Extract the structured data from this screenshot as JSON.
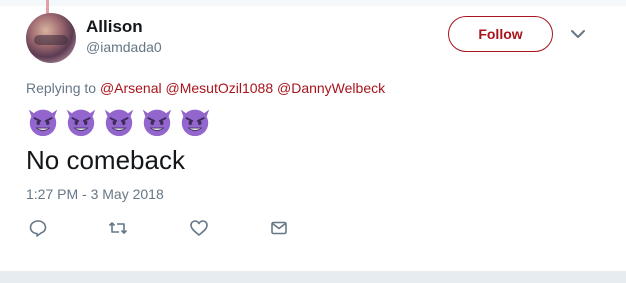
{
  "user": {
    "name": "Allison",
    "handle": "@iamdada0"
  },
  "follow_button": {
    "label": "Follow"
  },
  "reply_context": {
    "prefix": "Replying to",
    "mentions": [
      "@Arsenal",
      "@MesutOzil1088",
      "@DannyWelbeck"
    ]
  },
  "tweet": {
    "emojis": [
      "smiling-imp",
      "smiling-imp",
      "smiling-imp",
      "smiling-imp",
      "smiling-imp"
    ],
    "text": "No comeback",
    "timestamp": "1:27 PM - 3 May 2018"
  },
  "actions": [
    "reply-icon",
    "retweet-icon",
    "like-icon",
    "direct-message-icon"
  ],
  "colors": {
    "accent": "#a8141c",
    "secondary_text": "#657786",
    "primary_text": "#14171a",
    "emoji": "#9266cc"
  }
}
